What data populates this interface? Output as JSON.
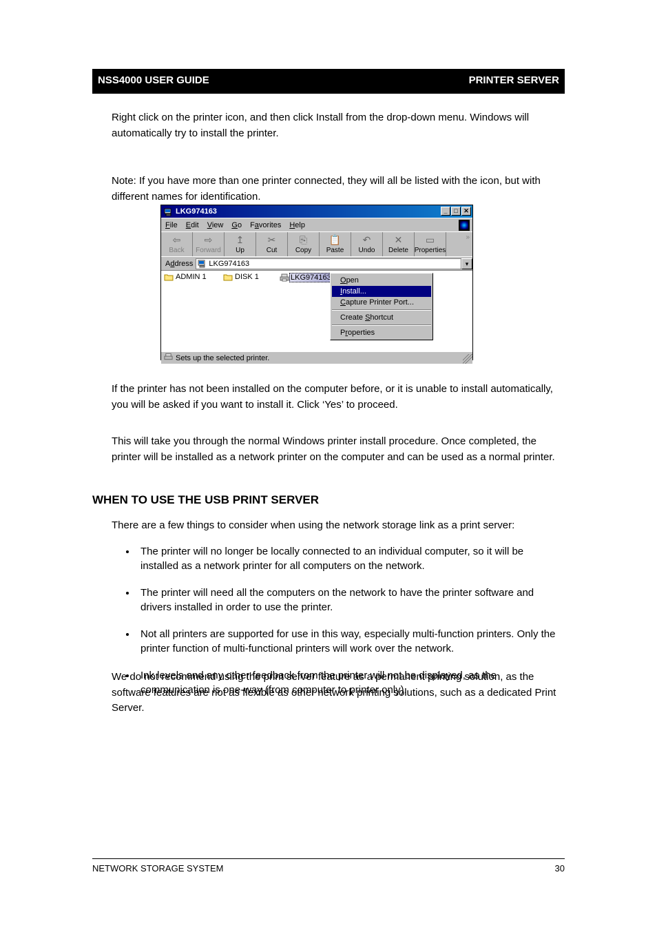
{
  "page_header": {
    "left": "NSS4000 USER GUIDE",
    "right": "PRINTER SERVER"
  },
  "intro_p1": "Right click on the printer icon, and then click Install from the drop-down menu. Windows will automatically try to install the printer.",
  "intro_p2": "Note: If you have more than one printer connected, they will all be listed with the icon, but with different names for identification.",
  "screenshot": {
    "title": "LKG974163",
    "menus": [
      "File",
      "Edit",
      "View",
      "Go",
      "Favorites",
      "Help"
    ],
    "menu_underlines": [
      "F",
      "E",
      "V",
      "G",
      "a",
      "H"
    ],
    "toolbar": [
      {
        "label": "Back",
        "glyph": "⇦",
        "enabled": false
      },
      {
        "label": "Forward",
        "glyph": "⇨",
        "enabled": false
      },
      {
        "label": "Up",
        "glyph": "↥",
        "enabled": true
      },
      {
        "label": "Cut",
        "glyph": "✂",
        "enabled": true
      },
      {
        "label": "Copy",
        "glyph": "⎘",
        "enabled": true
      },
      {
        "label": "Paste",
        "glyph": "📋",
        "enabled": true
      },
      {
        "label": "Undo",
        "glyph": "↶",
        "enabled": true
      },
      {
        "label": "Delete",
        "glyph": "✕",
        "enabled": true
      },
      {
        "label": "Properties",
        "glyph": "▭",
        "enabled": true
      }
    ],
    "address_label": "Address",
    "address_value": "LKG974163",
    "items": [
      {
        "name": "ADMIN 1",
        "type": "folder"
      },
      {
        "name": "DISK 1",
        "type": "folder"
      },
      {
        "name": "LKG974163_",
        "type": "printer"
      }
    ],
    "ctx": {
      "open": "Open",
      "install": "Install...",
      "capture": "Capture Printer Port...",
      "shortcut": "Create Shortcut",
      "properties": "Properties"
    },
    "status": "Sets up the selected printer."
  },
  "para3": "If the printer has not been installed on the computer before, or it is unable to install automatically, you will be asked if you want to install it. Click ‘Yes’ to proceed.",
  "para4": "This will take you through the normal Windows printer install procedure. Once completed, the printer will be installed as a network printer on the computer and can be used as a normal printer.",
  "heading": "WHEN TO USE THE USB PRINT SERVER",
  "para5": "There are a few things to consider when using the network storage link as a print server:",
  "bullets": [
    "The printer will no longer be locally connected to an individual computer, so it will be installed as a network printer for all computers on the network.",
    "The printer will need all the computers on the network to have the printer software and drivers installed in order to use the printer.",
    "Not all printers are supported for use in this way, especially multi-function printers. Only the printer function of multi-functional printers will work over the network.",
    "Ink levels and any other feedback from the printer will not be displayed, as the communication is one-way (from computer to printer only)."
  ],
  "para6": "We do not recommend using the print server feature as a permanent printing solution, as the software features are not as flexible as other network printing solutions, such as a dedicated Print Server.",
  "footer": {
    "left": "NETWORK STORAGE SYSTEM",
    "right": "30"
  }
}
